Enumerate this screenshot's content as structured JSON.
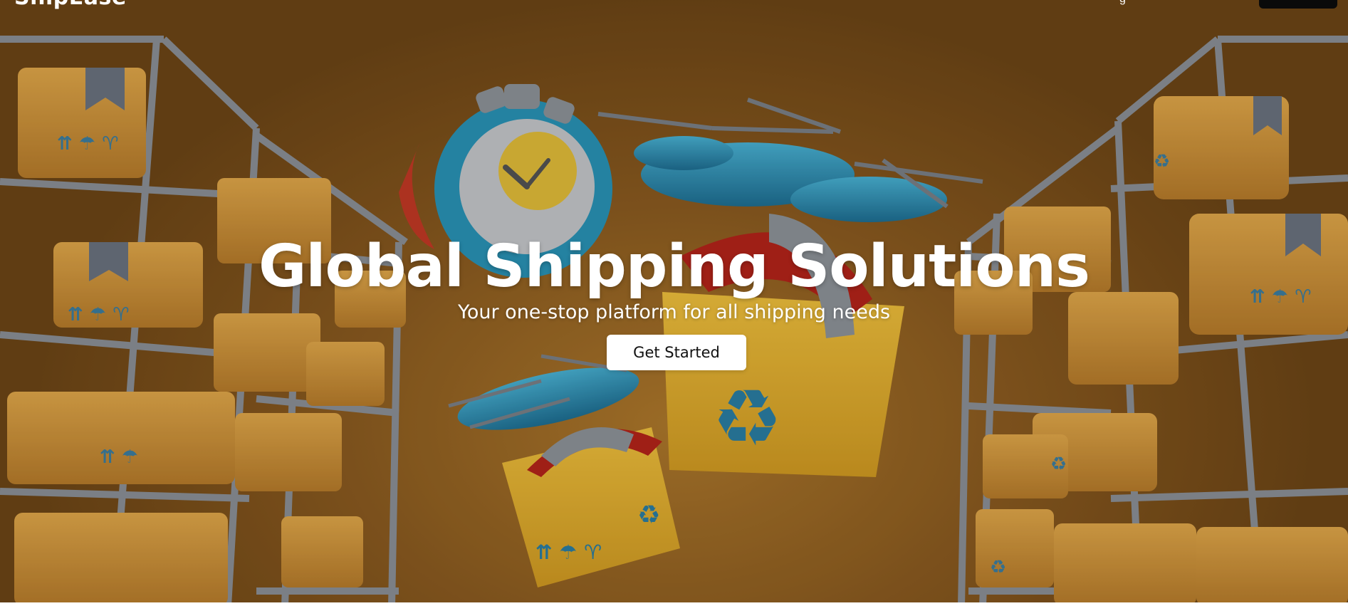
{
  "brand": {
    "name": "ShipEase"
  },
  "nav": {
    "partial_link": "g",
    "cta_label": ""
  },
  "hero": {
    "title": "Global Shipping Solutions",
    "subtitle": "Your one-stop platform for all shipping needs",
    "cta_label": "Get Started"
  },
  "colors": {
    "background": "#8a5a1f",
    "box": "#d69a3a",
    "shelf": "#8f949a",
    "drone": "#2b93b8",
    "recycle": "#2b7fa4",
    "button_bg": "#ffffff",
    "button_text": "#111111",
    "nav_button": "#0a0a0a"
  },
  "icons": [
    "stopwatch-icon",
    "drone-icon",
    "package-icon",
    "recycle-icon",
    "this-way-up-icon"
  ]
}
